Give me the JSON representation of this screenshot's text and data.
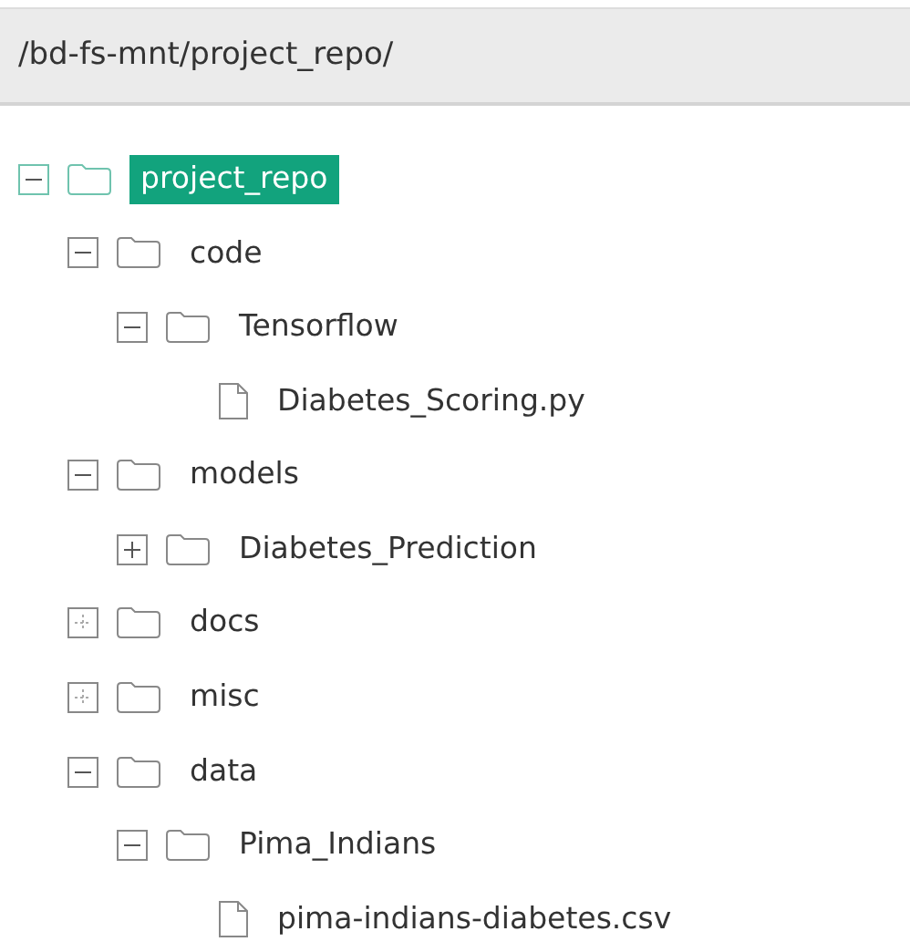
{
  "path_bar": {
    "path": "/bd-fs-mnt/project_repo/"
  },
  "tree": [
    {
      "kind": "folder",
      "label": "project_repo",
      "selected": true,
      "expanded": true,
      "loaded": true,
      "children": [
        {
          "kind": "folder",
          "label": "code",
          "selected": false,
          "expanded": true,
          "loaded": true,
          "children": [
            {
              "kind": "folder",
              "label": "Tensorflow",
              "selected": false,
              "expanded": true,
              "loaded": true,
              "children": [
                {
                  "kind": "file",
                  "label": "Diabetes_Scoring.py",
                  "selected": false
                }
              ]
            }
          ]
        },
        {
          "kind": "folder",
          "label": "models",
          "selected": false,
          "expanded": true,
          "loaded": true,
          "children": [
            {
              "kind": "folder",
              "label": "Diabetes_Prediction",
              "selected": false,
              "expanded": false,
              "loaded": true
            }
          ]
        },
        {
          "kind": "folder",
          "label": "docs",
          "selected": false,
          "expanded": false,
          "loaded": false
        },
        {
          "kind": "folder",
          "label": "misc",
          "selected": false,
          "expanded": false,
          "loaded": false
        },
        {
          "kind": "folder",
          "label": "data",
          "selected": false,
          "expanded": true,
          "loaded": true,
          "children": [
            {
              "kind": "folder",
              "label": "Pima_Indians",
              "selected": false,
              "expanded": true,
              "loaded": true,
              "children": [
                {
                  "kind": "file",
                  "label": "pima-indians-diabetes.csv",
                  "selected": false
                }
              ]
            }
          ]
        }
      ]
    }
  ]
}
